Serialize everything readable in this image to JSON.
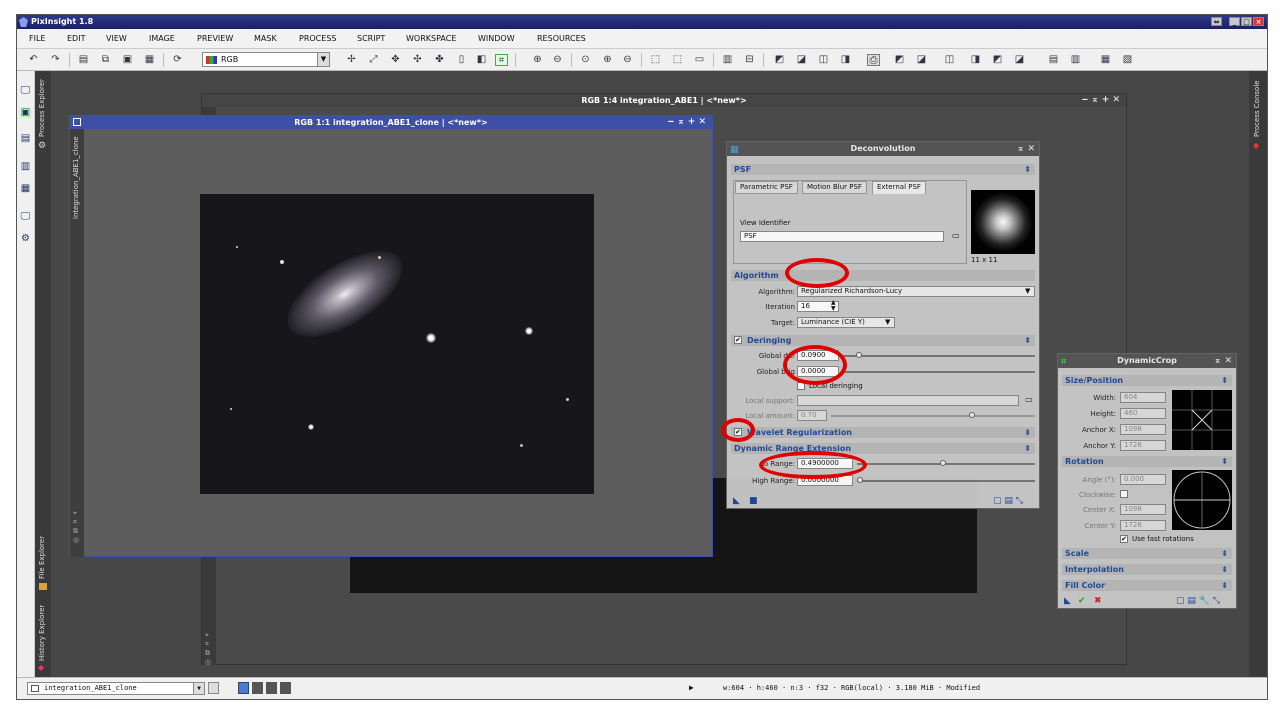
{
  "app": {
    "title": "PixInsight 1.8"
  },
  "menu": [
    "FILE",
    "EDIT",
    "VIEW",
    "IMAGE",
    "PREVIEW",
    "MASK",
    "PROCESS",
    "SCRIPT",
    "WORKSPACE",
    "WINDOW",
    "RESOURCES"
  ],
  "toolbar": {
    "color_mode": "RGB"
  },
  "side_tabs": {
    "process_explorer": "Process Explorer",
    "file_explorer": "File Explorer",
    "history_explorer": "History Explorer",
    "process_console": "Process Console",
    "image_tab": "integration_ABE1_clone"
  },
  "windows": {
    "back_title": "RGB 1:4 integration_ABE1 | <*new*>",
    "front_title": "RGB 1:1 integration_ABE1_clone | <*new*>"
  },
  "deconvolution": {
    "title": "Deconvolution",
    "psf_section": "PSF",
    "tabs": [
      "Parametric PSF",
      "Motion Blur PSF",
      "External PSF"
    ],
    "view_identifier_label": "View Identifier",
    "view_identifier": "PSF",
    "psf_size": "11 x 11",
    "algorithm_section": "Algorithm",
    "algorithm_label": "Algorithm:",
    "algorithm_value": "Regularized Richardson-Lucy",
    "iterations_label": "Iteration",
    "iterations_value": "16",
    "target_label": "Target:",
    "target_value": "Luminance (CIE Y)",
    "deringing_section": "Deringing",
    "global_dark_label": "Global dar",
    "global_dark_value": "0.0900",
    "global_bright_label": "Global brig",
    "global_bright_value": "0.0000",
    "local_deringing_label": "Local deringing",
    "local_support_label": "Local support:",
    "local_amount_label": "Local amount:",
    "local_amount_value": "0.70",
    "wavelet_section": "Wavelet Regularization",
    "dre_section": "Dynamic Range Extension",
    "low_range_label": "Lo  Range:",
    "low_range_value": "0.4900000",
    "high_range_label": "High Range:",
    "high_range_value": "0.0000000"
  },
  "dynamiccrop": {
    "title": "DynamicCrop",
    "size_section": "Size/Position",
    "width_label": "Width:",
    "width_value": "604",
    "height_label": "Height:",
    "height_value": "460",
    "anchor_x_label": "Anchor X:",
    "anchor_x_value": "1098",
    "anchor_y_label": "Anchor Y:",
    "anchor_y_value": "1726",
    "rotation_section": "Rotation",
    "angle_label": "Angle (°):",
    "angle_value": "0.000",
    "clockwise_label": "Clockwise:",
    "center_x_label": "Center X:",
    "center_x_value": "1098",
    "center_y_label": "Center Y:",
    "center_y_value": "1726",
    "fast_rotations_label": "Use fast rotations",
    "scale_section": "Scale",
    "interpolation_section": "Interpolation",
    "fill_section": "Fill Color"
  },
  "status": {
    "view_name": "integration_ABE1_clone",
    "info": "w:604 · h:460 · n:3 · f32 · RGB(local) · 3.180 MiB · Modified"
  }
}
